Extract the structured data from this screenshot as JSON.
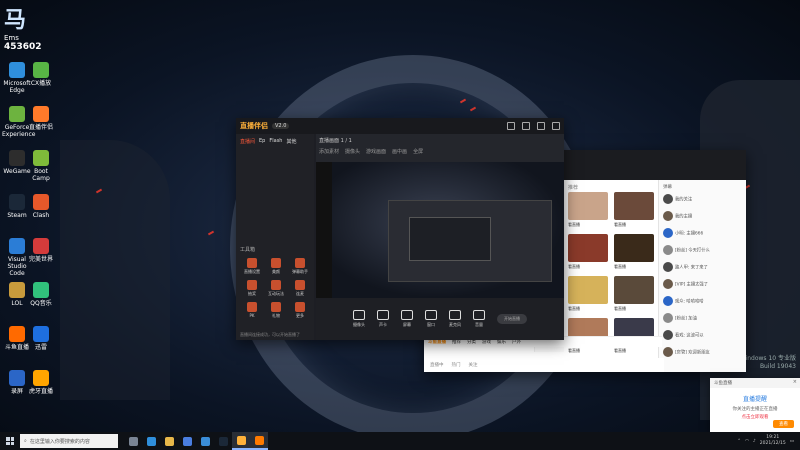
{
  "desktop": {
    "widget": {
      "logo": "马",
      "label": "Ems",
      "number": "453602"
    },
    "icons": [
      {
        "label": "Microsoft Edge",
        "color": "#2f8fdc"
      },
      {
        "label": "CX播放",
        "color": "#58b545"
      },
      {
        "label": "GeForce Experience",
        "color": "#6db33f"
      },
      {
        "label": "直播伴侣",
        "color": "#ff7a2a"
      },
      {
        "label": "WeGame",
        "color": "#2d2d2d"
      },
      {
        "label": "Boot Camp",
        "color": "#7fbb3a"
      },
      {
        "label": "Steam",
        "color": "#1b2838"
      },
      {
        "label": "Clash",
        "color": "#e6582a"
      },
      {
        "label": "Visual Studio Code",
        "color": "#2b7dd6"
      },
      {
        "label": "完美世界",
        "color": "#d43b3b"
      },
      {
        "label": "LOL",
        "color": "#c89b3c"
      },
      {
        "label": "QQ音乐",
        "color": "#31c27c"
      },
      {
        "label": "斗鱼直播",
        "color": "#ff6a00"
      },
      {
        "label": "迅雷",
        "color": "#1e6fdf"
      },
      {
        "label": "录屏",
        "color": "#2b66c7"
      },
      {
        "label": "虎牙直播",
        "color": "#ffa500"
      }
    ],
    "watermark": [
      "Windows 10 专业版",
      "Build 19043"
    ]
  },
  "live_window": {
    "logo": "直播伴侣",
    "version": "V2.0",
    "tabs": [
      "直播间",
      "Ep",
      "Flash",
      "其他"
    ],
    "room_label": "直播间",
    "tools_label": "工具箱",
    "tools": [
      "直播设置",
      "美颜",
      "弹幕助手",
      "抽奖",
      "互动玩法",
      "连麦",
      "PK",
      "礼物",
      "更多"
    ],
    "status": "直播间连接成功，可以开始直播了",
    "main_head": "直播画面 1 / 1",
    "main_sub": [
      "添加素材",
      "摄像头",
      "游戏画面",
      "画中画",
      "全屏"
    ],
    "controls": [
      "摄像头",
      "声卡",
      "屏幕",
      "窗口",
      "麦克风",
      "音量"
    ],
    "start_button": "开始直播"
  },
  "stream_window": {
    "grid_header": "推荐",
    "thumb_caption": "看直播",
    "chat_header": "弹幕",
    "chat": [
      "我的关注",
      "我的主播",
      "小明: 主播666",
      "[粉丝] 今天打什么",
      "路人甲: 来了来了",
      "[VIP] 主播太强了",
      "观众: 哈哈哈哈",
      "[粉丝] 加油",
      "看戏: 这波可以",
      "[房管] 欢迎新朋友"
    ],
    "bottom_logo": "斗鱼直播",
    "bottom_links": [
      "推荐",
      "分类",
      "游戏",
      "娱乐",
      "户外"
    ],
    "bottom_bar2": [
      "直播中",
      "热门",
      "关注"
    ]
  },
  "notification": {
    "title": "斗鱼直播",
    "heading": "直播提醒",
    "line1": "你关注的主播正在直播",
    "line2": "点击立即观看",
    "button": "查看"
  },
  "taskbar": {
    "search_placeholder": "在这里输入你要搜索的内容",
    "apps": [
      {
        "name": "task-view",
        "color": "#7a8595"
      },
      {
        "name": "edge",
        "color": "#2f8fdc"
      },
      {
        "name": "explorer",
        "color": "#e8b84a"
      },
      {
        "name": "store",
        "color": "#4a7ee0"
      },
      {
        "name": "mail",
        "color": "#3a8dd8"
      },
      {
        "name": "steam",
        "color": "#1b2838"
      },
      {
        "name": "live-companion",
        "color": "#ffb13a"
      },
      {
        "name": "douyu",
        "color": "#ff7a00"
      }
    ],
    "time": "19:21",
    "date": "2021/12/15"
  }
}
